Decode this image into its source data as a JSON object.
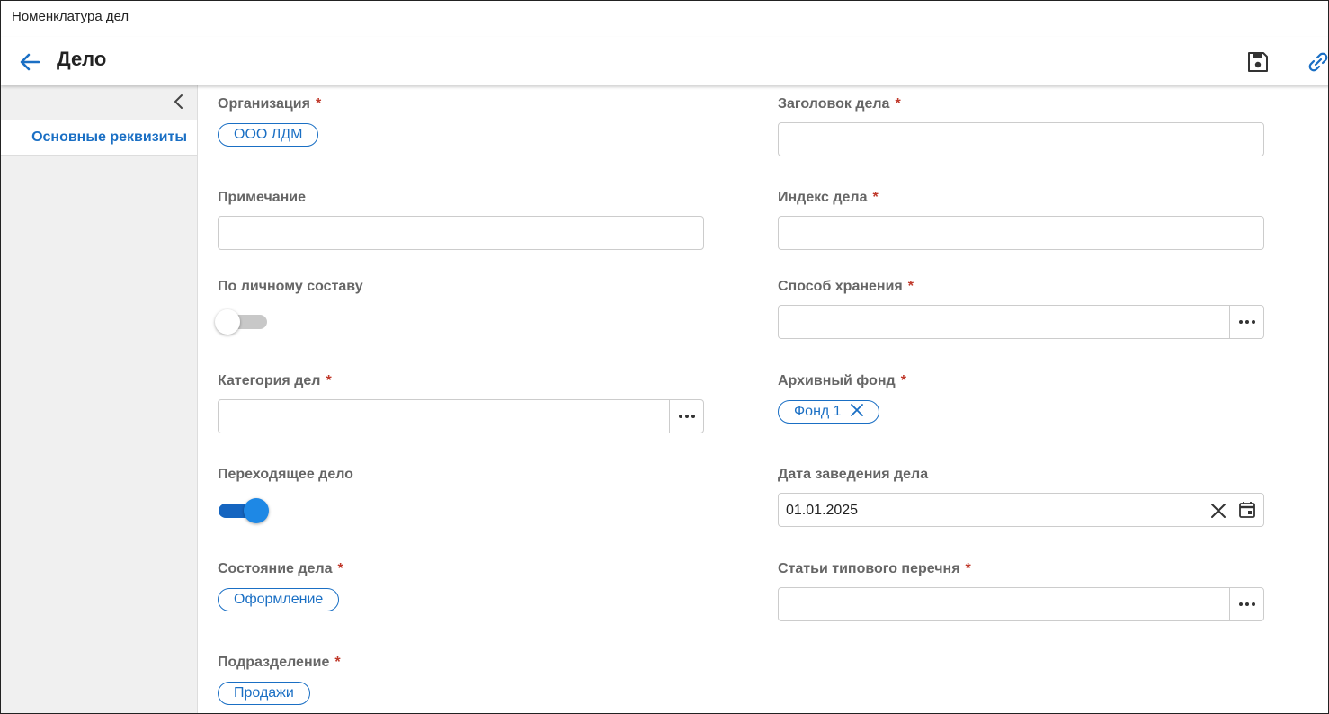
{
  "window": {
    "title": "Номенклатура дел"
  },
  "header": {
    "title": "Дело"
  },
  "sidebar": {
    "items": [
      {
        "label": "Основные реквизиты"
      }
    ]
  },
  "form": {
    "required_mark": "*",
    "organization": {
      "label": "Организация",
      "value": "ООО ЛДМ"
    },
    "case_title": {
      "label": "Заголовок дела",
      "value": ""
    },
    "note": {
      "label": "Примечание",
      "value": ""
    },
    "case_index": {
      "label": "Индекс дела",
      "value": ""
    },
    "personnel": {
      "label": "По личному составу",
      "checked": false
    },
    "storage_method": {
      "label": "Способ хранения",
      "value": ""
    },
    "case_category": {
      "label": "Категория дел",
      "value": ""
    },
    "archive_fund": {
      "label": "Архивный фонд",
      "value": "Фонд 1"
    },
    "transitional": {
      "label": "Переходящее дело",
      "checked": true
    },
    "start_date": {
      "label": "Дата заведения дела",
      "value": "01.01.2025"
    },
    "case_state": {
      "label": "Состояние дела",
      "value": "Оформление"
    },
    "standard_list_articles": {
      "label": "Статьи типового перечня",
      "value": ""
    },
    "department": {
      "label": "Подразделение",
      "value": "Продажи"
    }
  },
  "colors": {
    "accent": "#1a6fc4",
    "required": "#c0392b",
    "sidebar_bg": "#f0f0f0"
  }
}
